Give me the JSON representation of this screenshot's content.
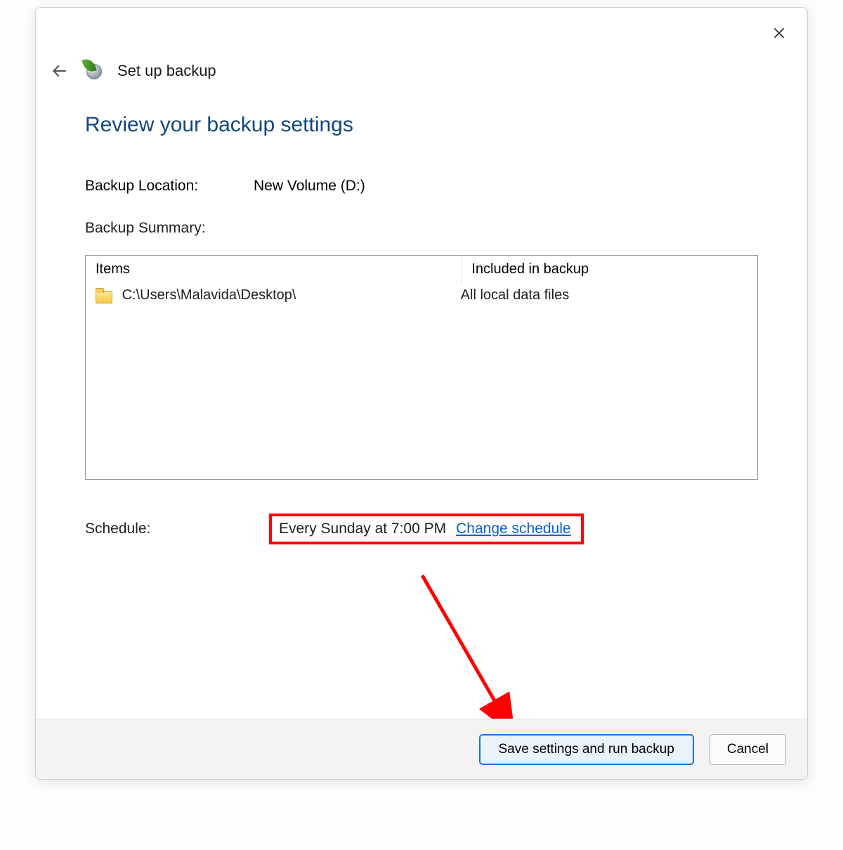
{
  "window": {
    "title": "Set up backup"
  },
  "heading": "Review your backup settings",
  "backup_location": {
    "label": "Backup Location:",
    "value": "New Volume (D:)"
  },
  "backup_summary_label": "Backup Summary:",
  "summary_table": {
    "columns": {
      "items": "Items",
      "included": "Included in backup"
    },
    "rows": [
      {
        "path": "C:\\Users\\Malavida\\Desktop\\",
        "included": "All local data files"
      }
    ]
  },
  "schedule": {
    "label": "Schedule:",
    "value": "Every Sunday at 7:00 PM",
    "change_link": "Change schedule"
  },
  "buttons": {
    "primary": "Save settings and run backup",
    "cancel": "Cancel"
  },
  "icons": {
    "close": "close-icon",
    "back": "back-arrow-icon",
    "wizard": "backup-wizard-icon",
    "folder": "folder-icon"
  },
  "annotation": {
    "highlight_color": "#ff0000"
  }
}
